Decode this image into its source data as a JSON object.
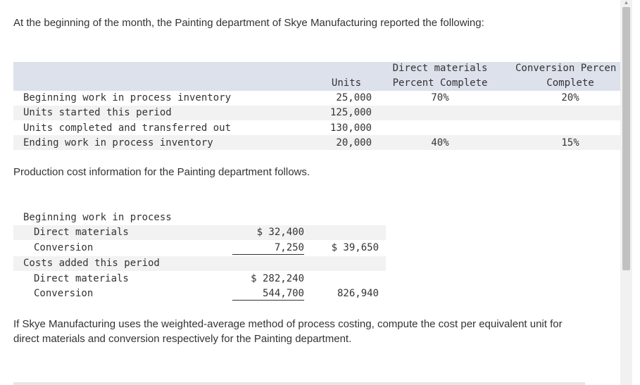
{
  "intro": "At the beginning of the month, the Painting department of Skye Manufacturing reported the following:",
  "units_table": {
    "headers": {
      "units": "Units",
      "dm_line1": "Direct materials",
      "dm_line2": "Percent Complete",
      "conv_line1": "Conversion Percen",
      "conv_line2": "Complete"
    },
    "rows": [
      {
        "label": "Beginning work in process inventory",
        "units": "25,000",
        "dm": "70%",
        "conv": "20%"
      },
      {
        "label": "Units started this period",
        "units": "125,000",
        "dm": "",
        "conv": ""
      },
      {
        "label": "Units completed and transferred out",
        "units": "130,000",
        "dm": "",
        "conv": ""
      },
      {
        "label": "Ending work in process inventory",
        "units": "20,000",
        "dm": "40%",
        "conv": "15%"
      }
    ]
  },
  "cost_intro": "Production cost information for the Painting department follows.",
  "cost_table": {
    "beginning_wip_label": "Beginning work in process",
    "beg_dm_label": "Direct materials",
    "beg_dm_value": "$ 32,400",
    "beg_conv_label": "Conversion",
    "beg_conv_value": "7,250",
    "beg_total": "$ 39,650",
    "added_label": "Costs added this period",
    "add_dm_label": "Direct materials",
    "add_dm_value": "$ 282,240",
    "add_conv_label": "Conversion",
    "add_conv_value": "544,700",
    "add_total": "826,940"
  },
  "question": "If Skye Manufacturing uses the weighted-average method of process costing, compute the cost per equivalent unit for direct materials and conversion respectively for the Painting department."
}
